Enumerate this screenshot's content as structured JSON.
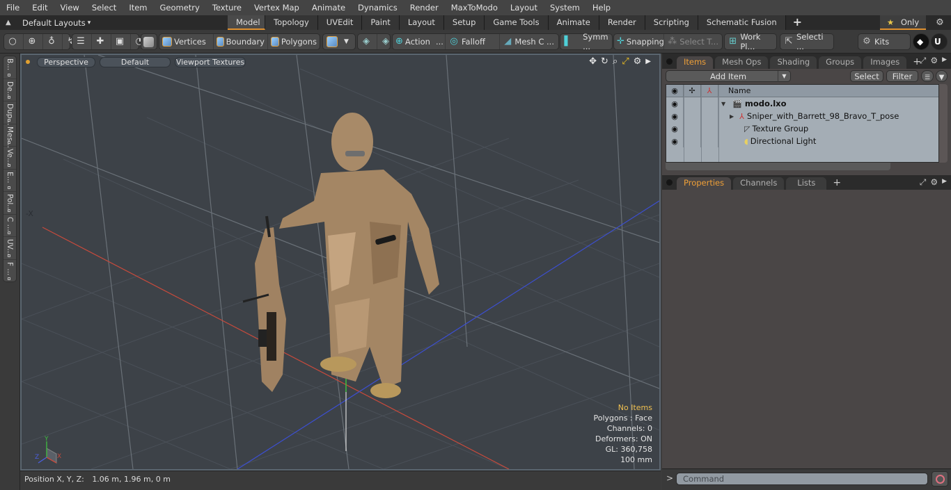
{
  "menu": [
    "File",
    "Edit",
    "View",
    "Select",
    "Item",
    "Geometry",
    "Texture",
    "Vertex Map",
    "Animate",
    "Dynamics",
    "Render",
    "MaxToModo",
    "Layout",
    "System",
    "Help"
  ],
  "layout_selector": {
    "label": "Default Layouts",
    "caret": "▾",
    "icon": "up-arrow-icon"
  },
  "layout_tabs": [
    {
      "label": "Model",
      "active": true
    },
    {
      "label": "Topology"
    },
    {
      "label": "UVEdit"
    },
    {
      "label": "Paint"
    },
    {
      "label": "Layout"
    },
    {
      "label": "Setup"
    },
    {
      "label": "Game Tools"
    },
    {
      "label": "Animate"
    },
    {
      "label": "Render"
    },
    {
      "label": "Scripting"
    },
    {
      "label": "Schematic Fusion"
    }
  ],
  "add_tab_label": "+",
  "only_button": {
    "star": "★",
    "label": "Only"
  },
  "toolbar": {
    "select_modes": {
      "vertices": "Vertices",
      "boundary": "Boundary",
      "polygons": "Polygons"
    },
    "action": "Action",
    "action_more": "...",
    "falloff": "Falloff",
    "mesh_c": "Mesh C ...",
    "symm": "Symm ...",
    "snapping": "Snapping",
    "select_t": "Select T...",
    "work_pl": "Work Pl...",
    "selecti": "Selecti ...",
    "kits": "Kits"
  },
  "left_tabs": [
    "B...",
    "De...",
    "Dup...",
    "Mes...",
    "Ve...",
    "E...",
    "Pol...",
    "C ...",
    "UV...",
    "F ..."
  ],
  "viewport": {
    "view_mode": "Perspective",
    "shading": "Default",
    "textures": "Viewport Textures",
    "stats": {
      "selection": "No Items",
      "polygons": "Polygons : Face",
      "channels": "Channels: 0",
      "deformers": "Deformers: ON",
      "gl": "GL: 360,758",
      "scale": "100 mm"
    },
    "axis_labels": {
      "x": "X",
      "y": "Y",
      "z": "Z"
    },
    "colors": {
      "x_axis": "#c84a3c",
      "y_axis": "#3fbf3f",
      "z_axis": "#3c4fd0",
      "selection_dot": "#e0a030"
    }
  },
  "status": {
    "label": "Position X, Y, Z:",
    "value": "1.06 m, 1.96 m, 0 m"
  },
  "items_panel": {
    "tabs": [
      {
        "label": "Items",
        "active": true
      },
      {
        "label": "Mesh Ops"
      },
      {
        "label": "Shading"
      },
      {
        "label": "Groups"
      },
      {
        "label": "Images"
      }
    ],
    "add_item": "Add Item",
    "select": "Select",
    "filter": "Filter",
    "name_header": "Name",
    "rows": [
      {
        "name": "modo.lxo",
        "icon": "clapper-icon",
        "bold": true,
        "expand": "▼"
      },
      {
        "name": "Sniper_with_Barrett_98_Bravo_T_pose",
        "icon": "locator-icon",
        "expand": "▶"
      },
      {
        "name": "Texture Group",
        "icon": "texture-group-icon"
      },
      {
        "name": "Directional Light",
        "icon": "light-icon"
      }
    ]
  },
  "props_panel": {
    "tabs": [
      {
        "label": "Properties",
        "active": true
      },
      {
        "label": "Channels"
      },
      {
        "label": "Lists"
      }
    ]
  },
  "command": {
    "prompt": ">",
    "placeholder": "Command"
  },
  "accent": "#e0902e"
}
